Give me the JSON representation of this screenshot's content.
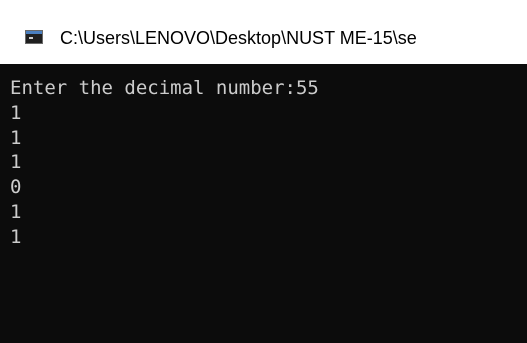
{
  "window": {
    "title": "C:\\Users\\LENOVO\\Desktop\\NUST ME-15\\se",
    "icon": "console-app-icon"
  },
  "console": {
    "lines": [
      "Enter the decimal number:55",
      "1",
      "1",
      "1",
      "0",
      "1",
      "1"
    ]
  },
  "colors": {
    "console_background": "#0c0c0c",
    "console_text": "#cccccc",
    "titlebar_background": "#ffffff"
  }
}
